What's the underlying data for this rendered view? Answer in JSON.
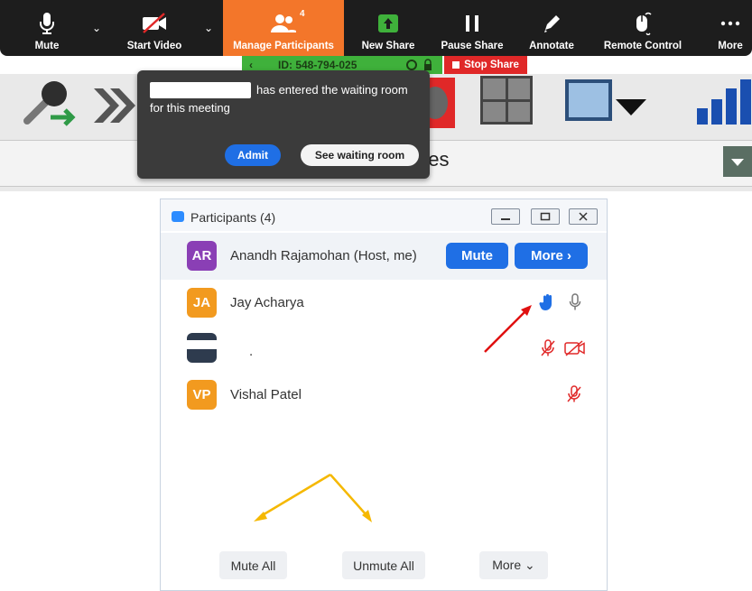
{
  "toolbar": {
    "mute": "Mute",
    "start_video": "Start Video",
    "manage_participants": "Manage Participants",
    "participants_count": "4",
    "new_share": "New Share",
    "pause_share": "Pause Share",
    "annotate": "Annotate",
    "remote_control": "Remote Control",
    "more": "More"
  },
  "share_bar": {
    "meeting_id": "ID: 548-794-025",
    "stop_share": "Stop Share"
  },
  "background_app": {
    "partial_text": "ries"
  },
  "notification": {
    "message_line1": "has entered the waiting room",
    "message_line2": "for this meeting",
    "admit": "Admit",
    "see_waiting_room": "See waiting room"
  },
  "participants_panel": {
    "title": "Participants (4)",
    "host": {
      "initials": "AR",
      "name": "Anandh Rajamohan (Host, me)",
      "mute_label": "Mute",
      "more_label": "More ›",
      "avatar_color": "#8a3fb5"
    },
    "rows": [
      {
        "initials": "JA",
        "name": "Jay Acharya",
        "avatar_color": "#f29a1f"
      },
      {
        "initials": "",
        "name": ".",
        "avatar_color": "#2e3b4e"
      },
      {
        "initials": "VP",
        "name": "Vishal Patel",
        "avatar_color": "#f29a1f"
      }
    ],
    "mute_all": "Mute All",
    "unmute_all": "Unmute All",
    "more": "More ⌄"
  },
  "colors": {
    "accent_orange": "#f3762a",
    "accent_blue": "#1f6fe5",
    "annotation_red": "#e01010",
    "annotation_yellow": "#f5b800"
  }
}
